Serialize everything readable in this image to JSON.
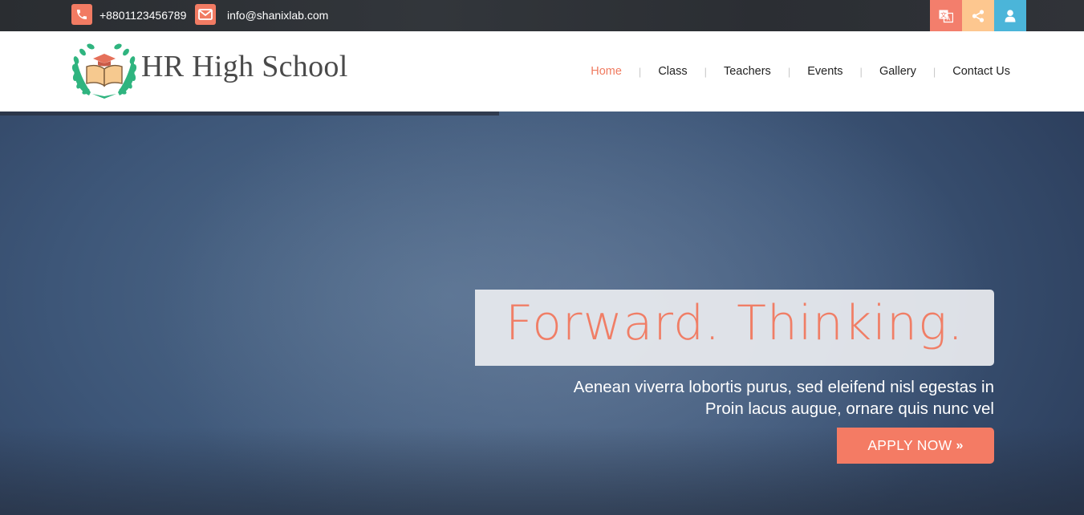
{
  "topbar": {
    "phone": "+8801123456789",
    "email": "info@shanixlab.com",
    "icons": [
      "phone-icon",
      "envelope-icon",
      "translate-icon",
      "share-icon",
      "user-icon"
    ],
    "colors": {
      "accent": "#f17b63",
      "share": "#fdc78f",
      "user": "#4bb5d9"
    }
  },
  "header": {
    "title": "HR High School",
    "nav": [
      "Home",
      "Class",
      "Teachers",
      "Events",
      "Gallery",
      "Contact Us"
    ],
    "active": "Home"
  },
  "hero": {
    "headline": "Forward. Thinking.",
    "subtext_line1": "Aenean viverra lobortis purus, sed eleifend nisl egestas in",
    "subtext_line2": "Proin lacus augue, ornare quis nunc vel",
    "cta": "APPLY NOW",
    "cta_icon": "double-chevron-right-icon"
  }
}
